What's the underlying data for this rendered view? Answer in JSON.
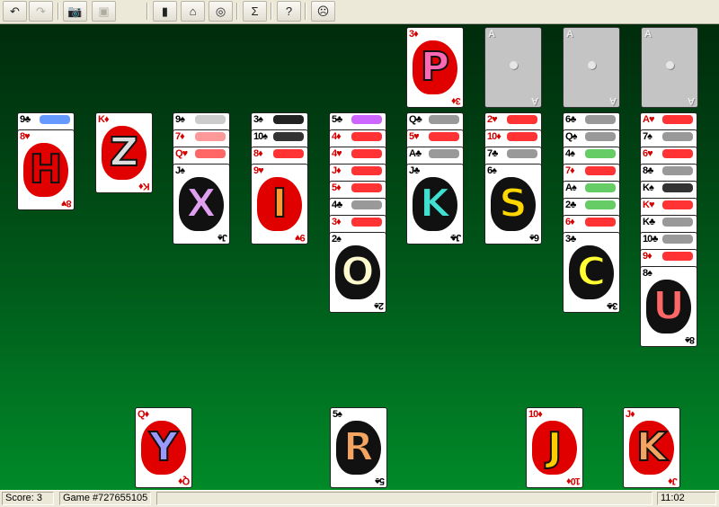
{
  "toolbar": {
    "buttons": [
      {
        "name": "undo-button",
        "icon": "undo-icon",
        "glyph": "↶",
        "enabled": true
      },
      {
        "name": "redo-button",
        "icon": "redo-icon",
        "glyph": "↷",
        "enabled": false
      },
      {
        "name": "screenshot-button",
        "icon": "camera-icon",
        "glyph": "📷",
        "enabled": true
      },
      {
        "name": "hint-button",
        "icon": "hint-icon",
        "glyph": "▣",
        "enabled": false
      },
      {
        "name": "deck-button",
        "icon": "card-deck-icon",
        "glyph": "▮",
        "enabled": true
      },
      {
        "name": "home-button",
        "icon": "home-icon",
        "glyph": "⌂",
        "enabled": true
      },
      {
        "name": "search-game-button",
        "icon": "magnifier-icon",
        "glyph": "◎",
        "enabled": true
      },
      {
        "name": "statistics-button",
        "icon": "sigma-icon",
        "glyph": "Σ",
        "enabled": true
      },
      {
        "name": "help-button",
        "icon": "question-icon",
        "glyph": "?",
        "enabled": true
      },
      {
        "name": "smiley-button",
        "icon": "smiley-face-icon",
        "glyph": "☹",
        "enabled": true
      }
    ]
  },
  "foundations": [
    {
      "type": "card",
      "rank": "3",
      "suit": "♦",
      "color": "red",
      "letter": "P",
      "letter_color": "#ff69b4",
      "blob": "red"
    },
    {
      "type": "empty",
      "label": "A"
    },
    {
      "type": "empty",
      "label": "A"
    },
    {
      "type": "empty",
      "label": "A"
    }
  ],
  "tableau": [
    [
      {
        "rank": "9",
        "suit": "♣",
        "color": "black",
        "peek": "#6699ff"
      },
      {
        "rank": "8",
        "suit": "♥",
        "color": "red",
        "letter": "H",
        "letter_color": "#e00000",
        "blob": "red"
      }
    ],
    [
      {
        "rank": "K",
        "suit": "♦",
        "color": "red",
        "letter": "Z",
        "letter_color": "#dddddd",
        "blob": "red"
      }
    ],
    [
      {
        "rank": "9",
        "suit": "♠",
        "color": "black",
        "peek": "#cccccc"
      },
      {
        "rank": "7",
        "suit": "♦",
        "color": "red",
        "peek": "#ff9999"
      },
      {
        "rank": "Q",
        "suit": "♥",
        "color": "red",
        "peek": "#ff6666"
      },
      {
        "rank": "J",
        "suit": "♠",
        "color": "black",
        "letter": "X",
        "letter_color": "#e0a0f0",
        "blob": "black"
      }
    ],
    [
      {
        "rank": "3",
        "suit": "♠",
        "color": "black",
        "peek": "#222222"
      },
      {
        "rank": "10",
        "suit": "♠",
        "color": "black",
        "peek": "#333333"
      },
      {
        "rank": "8",
        "suit": "♦",
        "color": "red",
        "peek": "#ff3333"
      },
      {
        "rank": "9",
        "suit": "♥",
        "color": "red",
        "letter": "I",
        "letter_color": "#ff9933",
        "blob": "red"
      }
    ],
    [
      {
        "rank": "5",
        "suit": "♣",
        "color": "black",
        "peek": "#cc66ff"
      },
      {
        "rank": "4",
        "suit": "♦",
        "color": "red",
        "peek": "#ff3333"
      },
      {
        "rank": "4",
        "suit": "♥",
        "color": "red",
        "peek": "#ff3333"
      },
      {
        "rank": "J",
        "suit": "♦",
        "color": "red",
        "peek": "#ff3333"
      },
      {
        "rank": "5",
        "suit": "♦",
        "color": "red",
        "peek": "#ff3333"
      },
      {
        "rank": "4",
        "suit": "♣",
        "color": "black",
        "peek": "#999999"
      },
      {
        "rank": "3",
        "suit": "♦",
        "color": "red",
        "peek": "#ff3333"
      },
      {
        "rank": "2",
        "suit": "♠",
        "color": "black",
        "letter": "O",
        "letter_color": "#fffacd",
        "blob": "black"
      }
    ],
    [
      {
        "rank": "Q",
        "suit": "♣",
        "color": "black",
        "peek": "#999999"
      },
      {
        "rank": "5",
        "suit": "♥",
        "color": "red",
        "peek": "#ff3333"
      },
      {
        "rank": "A",
        "suit": "♣",
        "color": "black",
        "peek": "#999999"
      },
      {
        "rank": "J",
        "suit": "♣",
        "color": "black",
        "letter": "K",
        "letter_color": "#40e0d0",
        "blob": "black"
      }
    ],
    [
      {
        "rank": "2",
        "suit": "♥",
        "color": "red",
        "peek": "#ff3333"
      },
      {
        "rank": "10",
        "suit": "♦",
        "color": "red",
        "peek": "#ff3333"
      },
      {
        "rank": "7",
        "suit": "♣",
        "color": "black",
        "peek": "#999999"
      },
      {
        "rank": "6",
        "suit": "♠",
        "color": "black",
        "letter": "S",
        "letter_color": "#ffd700",
        "blob": "black"
      }
    ],
    [
      {
        "rank": "6",
        "suit": "♣",
        "color": "black",
        "peek": "#999999"
      },
      {
        "rank": "Q",
        "suit": "♠",
        "color": "black",
        "peek": "#999999"
      },
      {
        "rank": "4",
        "suit": "♠",
        "color": "black",
        "peek": "#66cc66"
      },
      {
        "rank": "7",
        "suit": "♦",
        "color": "red",
        "peek": "#ff3333"
      },
      {
        "rank": "A",
        "suit": "♠",
        "color": "black",
        "peek": "#66cc66"
      },
      {
        "rank": "2",
        "suit": "♣",
        "color": "black",
        "peek": "#66cc66"
      },
      {
        "rank": "6",
        "suit": "♦",
        "color": "red",
        "peek": "#ff3333"
      },
      {
        "rank": "3",
        "suit": "♣",
        "color": "black",
        "letter": "C",
        "letter_color": "#ffff33",
        "blob": "black"
      }
    ],
    [
      {
        "rank": "A",
        "suit": "♥",
        "color": "red",
        "peek": "#ff3333"
      },
      {
        "rank": "7",
        "suit": "♠",
        "color": "black",
        "peek": "#999999"
      },
      {
        "rank": "6",
        "suit": "♥",
        "color": "red",
        "peek": "#ff3333"
      },
      {
        "rank": "8",
        "suit": "♣",
        "color": "black",
        "peek": "#999999"
      },
      {
        "rank": "K",
        "suit": "♠",
        "color": "black",
        "peek": "#333333"
      },
      {
        "rank": "K",
        "suit": "♥",
        "color": "red",
        "peek": "#ff3333"
      },
      {
        "rank": "K",
        "suit": "♣",
        "color": "black",
        "peek": "#999999"
      },
      {
        "rank": "10",
        "suit": "♣",
        "color": "black",
        "peek": "#999999"
      },
      {
        "rank": "9",
        "suit": "♦",
        "color": "red",
        "peek": "#ff3333"
      },
      {
        "rank": "8",
        "suit": "♠",
        "color": "black",
        "letter": "U",
        "letter_color": "#ff6666",
        "blob": "black"
      }
    ]
  ],
  "reserve": [
    {
      "rank": "Q",
      "suit": "♦",
      "color": "red",
      "letter": "Y",
      "letter_color": "#9999ff",
      "blob": "red"
    },
    {
      "rank": "5",
      "suit": "♠",
      "color": "black",
      "letter": "R",
      "letter_color": "#f4a460",
      "blob": "black"
    },
    {
      "rank": "10",
      "suit": "♦",
      "color": "red",
      "letter": "J",
      "letter_color": "#ffcc00",
      "blob": "red"
    },
    {
      "rank": "J",
      "suit": "♦",
      "color": "red",
      "letter": "K",
      "letter_color": "#f4a460",
      "blob": "red"
    }
  ],
  "status": {
    "score": "Score:  3",
    "game": "Game #727655105",
    "blank": "",
    "time": "11:02"
  }
}
